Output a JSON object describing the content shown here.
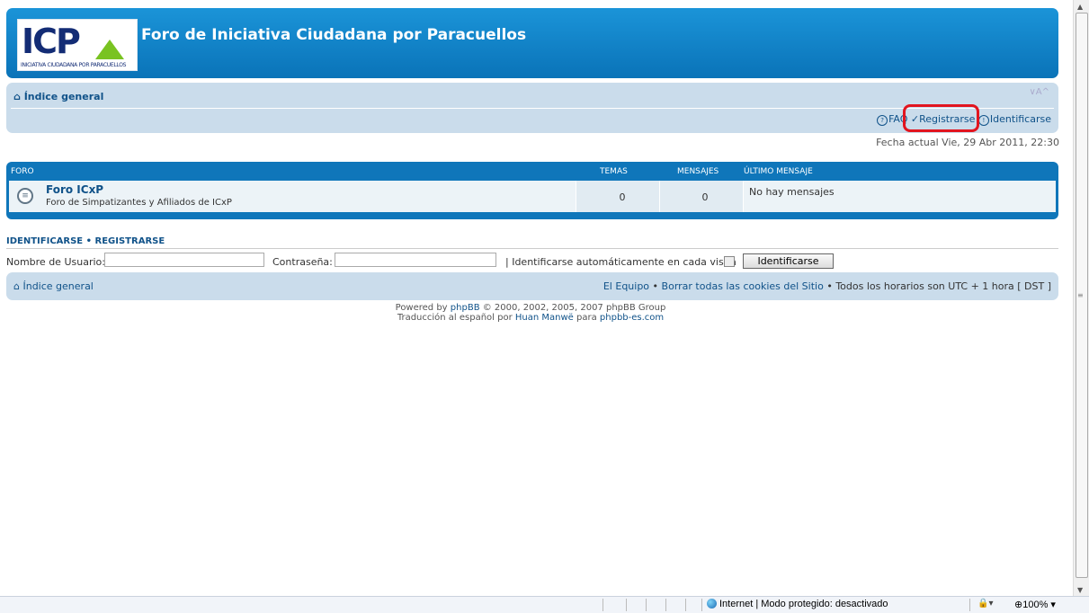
{
  "header": {
    "site_title": "Foro de Iniciativa Ciudadana por Paracuellos",
    "logo_text": "ICP",
    "logo_subtitle": "INICIATIVA CIUDADANA POR PARACUELLOS"
  },
  "navbar": {
    "index_link": "Índice general",
    "resize_text": "∨A^",
    "faq": "FAQ",
    "register": "Registrarse",
    "login": "Identificarse"
  },
  "date_line": "Fecha actual Vie, 29 Abr 2011, 22:30",
  "forum_table": {
    "headers": {
      "forum": "FORO",
      "topics": "TEMAS",
      "posts": "MENSAJES",
      "last_post": "ÚLTIMO MENSAJE"
    },
    "rows": [
      {
        "name": "Foro ICxP",
        "description": "Foro de Simpatizantes y Afiliados de ICxP",
        "topics": "0",
        "posts": "0",
        "last_post": "No hay mensajes"
      }
    ]
  },
  "login": {
    "heading_login": "IDENTIFICARSE",
    "heading_sep": "•",
    "heading_register": "REGISTRARSE",
    "username_label": "Nombre de Usuario:",
    "password_label": "Contraseña:",
    "auto_login_label": "| Identificarse automáticamente en cada visita",
    "submit_label": "Identificarse"
  },
  "footer_nav": {
    "index_link": "Índice general",
    "team": "El Equipo",
    "sep": "•",
    "delete_cookies": "Borrar todas las cookies del Sitio",
    "timezone": "• Todos los horarios son UTC + 1 hora [ DST ]"
  },
  "powered": {
    "line1_prefix": "Powered by",
    "phpbb": "phpBB",
    "line1_suffix": "© 2000, 2002, 2005, 2007 phpBB Group",
    "line2_prefix": "Traducción al español por",
    "translator": "Huan Manwë",
    "line2_mid": "para",
    "site": "phpbb-es.com"
  },
  "statusbar": {
    "zone_text": "Internet | Modo protegido: desactivado",
    "extra": "▾",
    "zoom": "100%"
  },
  "colors": {
    "header_blue": "#0a73b8",
    "navbar_bg": "#cadceb",
    "link": "#105289",
    "highlight_red": "#e2151f"
  }
}
